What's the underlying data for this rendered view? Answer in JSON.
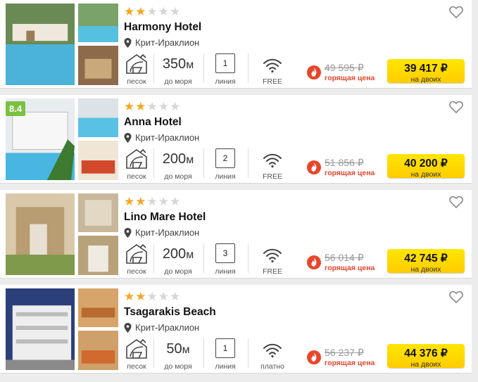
{
  "colors": {
    "star": "#f5a623",
    "star_empty": "#d6d6d6",
    "hot": "#e8462b",
    "button": "#ffd500",
    "rating_bg": "#7ac142"
  },
  "icons": {
    "beach": "beach-umbrella-icon",
    "location": "location-pin-icon",
    "wifi": "wifi-icon",
    "favorite": "heart-icon",
    "hot": "flame-icon"
  },
  "labels": {
    "beach": "песок",
    "distance_unit": "м",
    "distance_caption": "до моря",
    "line_caption": "линия",
    "hot_price": "горящая цена",
    "per_two": "на двоих"
  },
  "hotels": [
    {
      "stars": 2,
      "stars_max": 5,
      "name": "Harmony Hotel",
      "location": "Крит-Ираклион",
      "distance": "350",
      "line": "1",
      "wifi": "FREE",
      "old_price": "49 595 ₽",
      "price": "39 417 ₽",
      "rating": ""
    },
    {
      "stars": 2,
      "stars_max": 5,
      "name": "Anna Hotel",
      "location": "Крит-Ираклион",
      "distance": "200",
      "line": "2",
      "wifi": "FREE",
      "old_price": "51 856 ₽",
      "price": "40 200 ₽",
      "rating": "8.4"
    },
    {
      "stars": 2,
      "stars_max": 5,
      "name": "Lino Mare Hotel",
      "location": "Крит-Ираклион",
      "distance": "200",
      "line": "3",
      "wifi": "FREE",
      "old_price": "56 014 ₽",
      "price": "42 745 ₽",
      "rating": ""
    },
    {
      "stars": 2,
      "stars_max": 5,
      "name": "Tsagarakis Beach",
      "location": "Крит-Ираклион",
      "distance": "50",
      "line": "1",
      "wifi": "платно",
      "old_price": "56 237 ₽",
      "price": "44 376 ₽",
      "rating": ""
    }
  ]
}
